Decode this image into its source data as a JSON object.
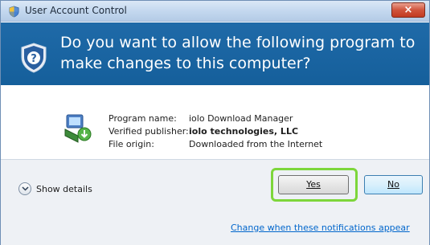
{
  "window": {
    "title": "User Account Control",
    "close_symbol": "×"
  },
  "header": {
    "question": "Do you want to allow the following program to make changes to this computer?"
  },
  "program": {
    "labels": {
      "name": "Program name:",
      "publisher": "Verified publisher:",
      "origin": "File origin:"
    },
    "values": {
      "name": "iolo Download Manager",
      "publisher": "iolo technologies, LLC",
      "origin": "Downloaded from the Internet"
    }
  },
  "footer": {
    "show_details": "Show details",
    "yes": "Yes",
    "no": "No",
    "notification_link": "Change when these notifications appear"
  },
  "icons": {
    "title": "uac-shield-icon",
    "header": "shield-icon",
    "program": "program-icon",
    "details": "chevron-down-icon"
  },
  "colors": {
    "header_bg": "#1f6aa8",
    "highlight": "#7dd63b",
    "link": "#0066cc"
  }
}
